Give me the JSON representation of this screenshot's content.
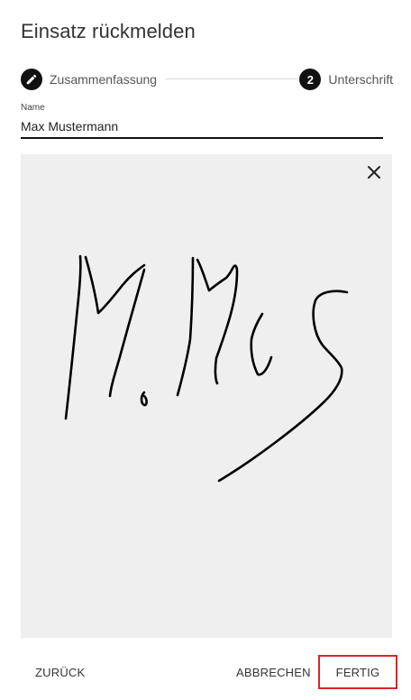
{
  "dialog": {
    "title": "Einsatz rückmelden"
  },
  "stepper": {
    "steps": [
      {
        "icon": "pencil-icon",
        "label": "Zusammenfassung"
      },
      {
        "number": "2",
        "label": "Unterschrift"
      }
    ]
  },
  "name_field": {
    "label": "Name",
    "value": "Max Mustermann"
  },
  "signature_pad": {
    "background": "#efefef",
    "stroke_color": "#000000",
    "close_icon": "close-icon"
  },
  "actions": {
    "back_label": "ZURÜCK",
    "cancel_label": "ABBRECHEN",
    "finish_label": "FERTIG",
    "highlight_color": "#d9252a"
  }
}
